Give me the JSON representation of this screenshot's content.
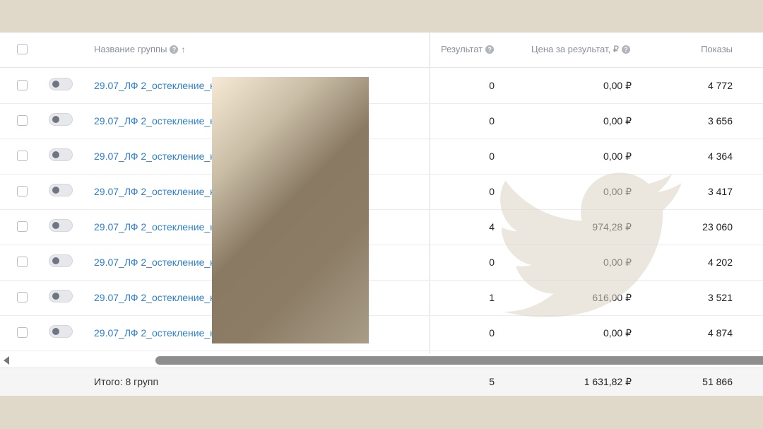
{
  "header": {
    "name_label": "Название группы",
    "sort_arrow": "↑",
    "result_label": "Результат",
    "price_label": "Цена за результат, ₽",
    "shows_label": "Показы",
    "help_glyph": "?"
  },
  "rows": [
    {
      "name": "29.07_ЛФ 2_остекление_к",
      "result": "0",
      "price": "0,00 ₽",
      "shows": "4 772"
    },
    {
      "name": "29.07_ЛФ 2_остекление_к",
      "result": "0",
      "price": "0,00 ₽",
      "shows": "3 656"
    },
    {
      "name": "29.07_ЛФ 2_остекление_к",
      "result": "0",
      "price": "0,00 ₽",
      "shows": "4 364"
    },
    {
      "name": "29.07_ЛФ 2_остекление_к",
      "result": "0",
      "price": "0,00 ₽",
      "shows": "3 417"
    },
    {
      "name": "29.07_ЛФ 2_остекление_к",
      "result": "4",
      "price": "974,28 ₽",
      "shows": "23 060"
    },
    {
      "name": "29.07_ЛФ 2_остекление_к",
      "result": "0",
      "price": "0,00 ₽",
      "shows": "4 202"
    },
    {
      "name": "29.07_ЛФ 2_остекление_к",
      "result": "1",
      "price": "616,00 ₽",
      "shows": "3 521"
    },
    {
      "name": "29.07_ЛФ 2_остекление_к",
      "result": "0",
      "price": "0,00 ₽",
      "shows": "4 874"
    }
  ],
  "footer": {
    "label": "Итого: 8 групп",
    "result": "5",
    "price": "1 631,82 ₽",
    "shows": "51 866"
  },
  "icons": {
    "help": "help-circle-icon",
    "scroll_left": "arrow-left-icon",
    "watermark": "twitter-bird-logo"
  },
  "colors": {
    "link": "#2d7fcf",
    "background": "#e0d8c8"
  }
}
